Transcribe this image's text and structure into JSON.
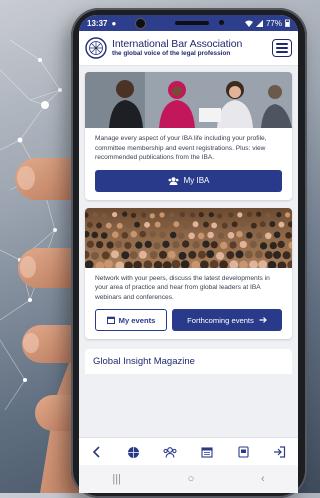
{
  "status": {
    "time": "13:37",
    "battery": "77%"
  },
  "header": {
    "org_name": "International Bar Association",
    "tagline": "the global voice of the legal profession"
  },
  "profile_card": {
    "text": "Manage every aspect of your IBA life including your profile, committee membership and event registrations. Plus: view recommended publications from the IBA.",
    "button_label": "My IBA"
  },
  "events_card": {
    "text": "Network with your peers, discuss the latest developments in your area of practice and hear from global leaders at IBA webinars and conferences.",
    "my_events_label": "My events",
    "forthcoming_label": "Forthcoming events"
  },
  "magazine": {
    "title": "Global Insight Magazine"
  },
  "bottom_nav": [
    "back-icon",
    "globe-icon",
    "people-icon",
    "calendar-icon",
    "book-icon",
    "logout-icon"
  ],
  "colors": {
    "brand": "#2a3a8a",
    "status_bar": "#2c3e8c"
  }
}
